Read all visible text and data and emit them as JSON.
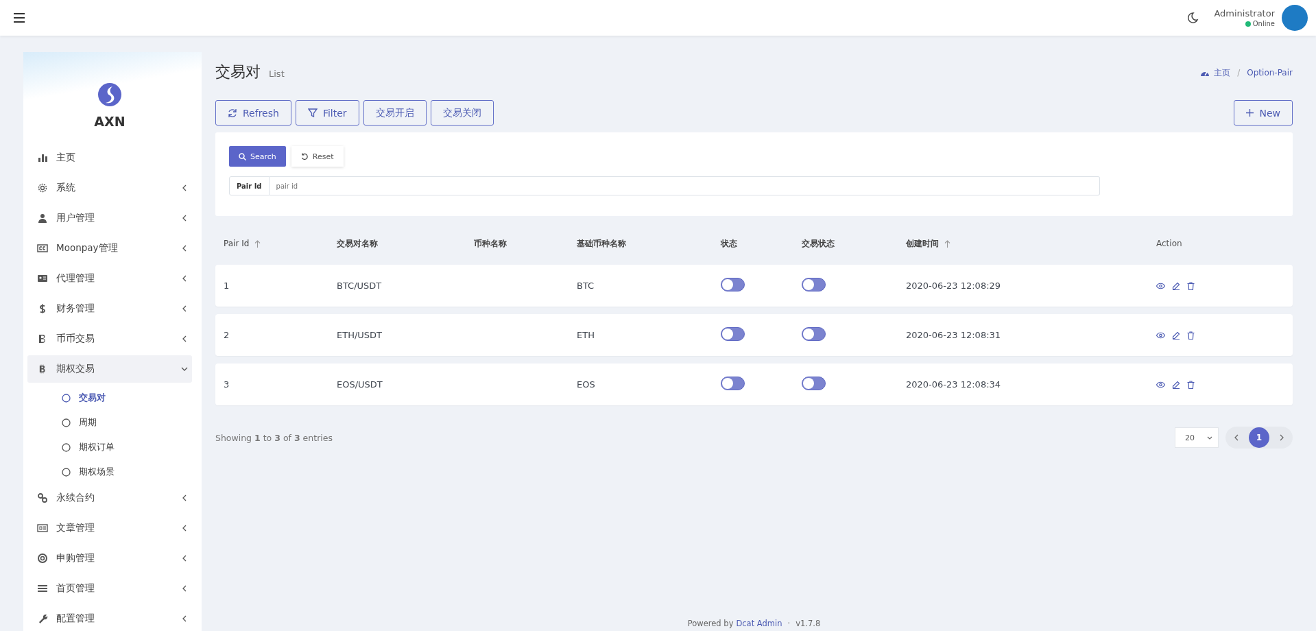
{
  "header": {
    "user": {
      "name": "Administrator",
      "status": "Online"
    }
  },
  "sidebar": {
    "brand": "AXN",
    "items": [
      {
        "label": "主页",
        "expandable": false,
        "expanded": false
      },
      {
        "label": "系统",
        "expandable": true,
        "expanded": false
      },
      {
        "label": "用户管理",
        "expandable": true,
        "expanded": false
      },
      {
        "label": "Moonpay管理",
        "expandable": true,
        "expanded": false
      },
      {
        "label": "代理管理",
        "expandable": true,
        "expanded": false
      },
      {
        "label": "财务管理",
        "expandable": true,
        "expanded": false
      },
      {
        "label": "币币交易",
        "expandable": true,
        "expanded": false
      },
      {
        "label": "期权交易",
        "expandable": true,
        "expanded": true,
        "children": [
          {
            "label": "交易对",
            "selected": true
          },
          {
            "label": "周期",
            "selected": false
          },
          {
            "label": "期权订单",
            "selected": false
          },
          {
            "label": "期权场景",
            "selected": false
          }
        ]
      },
      {
        "label": "永续合约",
        "expandable": true,
        "expanded": false
      },
      {
        "label": "文章管理",
        "expandable": true,
        "expanded": false
      },
      {
        "label": "申购管理",
        "expandable": true,
        "expanded": false
      },
      {
        "label": "首页管理",
        "expandable": true,
        "expanded": false
      },
      {
        "label": "配置管理",
        "expandable": true,
        "expanded": false
      }
    ]
  },
  "page": {
    "title": "交易对",
    "subtitle": "List",
    "breadcrumb": [
      "主页",
      "Option-Pair"
    ],
    "breadcrumb_separator": "/"
  },
  "toolbar": {
    "buttons": [
      {
        "label": "Refresh"
      },
      {
        "label": "Filter"
      },
      {
        "label": "交易开启"
      },
      {
        "label": "交易关闭"
      }
    ],
    "new_button": "New"
  },
  "filter": {
    "search_button": "Search",
    "reset_button": "Reset",
    "field_label": "Pair Id",
    "placeholder": "pair id"
  },
  "table": {
    "columns": [
      {
        "label": "Pair Id",
        "sortable": true
      },
      {
        "label": "交易对名称",
        "sortable": false
      },
      {
        "label": "币种名称",
        "sortable": false
      },
      {
        "label": "基础币种名称",
        "sortable": false
      },
      {
        "label": "状态",
        "sortable": false
      },
      {
        "label": "交易状态",
        "sortable": false
      },
      {
        "label": "创建时间",
        "sortable": true
      },
      {
        "label": "Action",
        "sortable": false
      }
    ],
    "rows": [
      {
        "id": "1",
        "pair": "BTC/USDT",
        "base": "BTC",
        "status_on": false,
        "trade_on": false,
        "created": "2020-06-23 12:08:29"
      },
      {
        "id": "2",
        "pair": "ETH/USDT",
        "base": "ETH",
        "status_on": false,
        "trade_on": false,
        "created": "2020-06-23 12:08:31"
      },
      {
        "id": "3",
        "pair": "EOS/USDT",
        "base": "EOS",
        "status_on": false,
        "trade_on": false,
        "created": "2020-06-23 12:08:34"
      }
    ]
  },
  "pagination": {
    "summary": "Showing **1** to **3** of **3** entries",
    "per_page": "20",
    "pages": [
      {
        "label": "1",
        "selected": true
      }
    ]
  },
  "footer": {
    "powered_by": "Powered by",
    "link": "Dcat Admin",
    "separator": "·",
    "version": "v1.7.8"
  }
}
